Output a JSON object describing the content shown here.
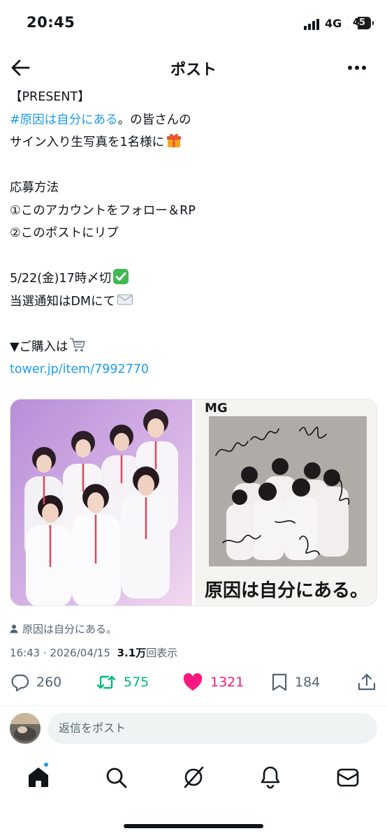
{
  "status_bar": {
    "time": "20:45",
    "network": "4G",
    "battery": "45",
    "battery_level": 0.45
  },
  "header": {
    "title": "ポスト"
  },
  "post": {
    "lines": [
      {
        "text": "【PRESENT】"
      },
      {
        "link": "#原因は自分にある",
        "text": "。の皆さんの"
      },
      {
        "text": "サイン入り生写真を1名様に",
        "emoji": "gift"
      },
      {
        "text": ""
      },
      {
        "text": "応募方法"
      },
      {
        "text": "①このアカウントをフォロー＆RP"
      },
      {
        "text": "②このポストにリプ"
      },
      {
        "text": ""
      },
      {
        "text": "5/22(金)17時〆切",
        "emoji": "check-mark"
      },
      {
        "text": "当選通知はDMにて",
        "emoji": "envelope"
      },
      {
        "text": ""
      },
      {
        "text": "▼ご購入は",
        "emoji": "shopping-cart"
      },
      {
        "link": "tower.jp/item/7992770"
      }
    ]
  },
  "media": {
    "left_image": "group-photo",
    "right_image": "signed-polaroid",
    "polaroid_caption": "原因は自分にある。",
    "polaroid_mark": "MG"
  },
  "author_label": "原因は自分にある。",
  "meta": {
    "time": "16:43",
    "separator": " · ",
    "date": "2026/04/15",
    "views_count": "3.1万",
    "views_suffix": "回表示"
  },
  "actions": {
    "replies": "260",
    "reposts": "575",
    "likes": "1321",
    "bookmarks": "184"
  },
  "reply_bar": {
    "placeholder": "返信をポスト"
  },
  "tabs": [
    "home-icon",
    "search-icon",
    "grok-icon",
    "notifications-icon",
    "messages-icon"
  ],
  "colors": {
    "link": "#1d9bf0",
    "repost": "#00ba7c",
    "like": "#f91880",
    "muted": "#536471"
  }
}
